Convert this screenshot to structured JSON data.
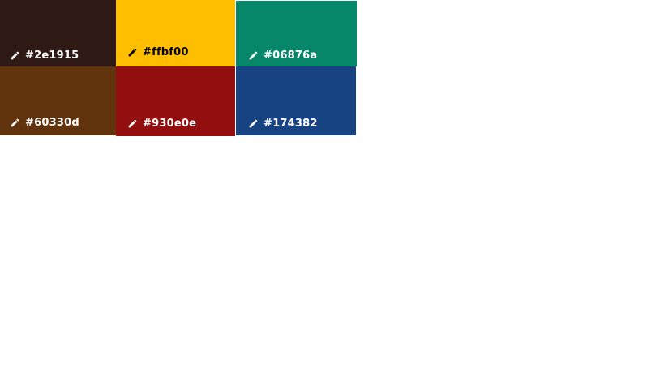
{
  "palette": {
    "swatches": [
      {
        "hex": "#2e1915",
        "label": "#2e1915",
        "text_color": "#ffffff",
        "icon": "pencil-icon"
      },
      {
        "hex": "#ffbf00",
        "label": "#ffbf00",
        "text_color": "#000000",
        "icon": "pencil-icon"
      },
      {
        "hex": "#06876a",
        "label": "#06876a",
        "text_color": "#ffffff",
        "icon": "pencil-icon"
      },
      {
        "hex": "#60330d",
        "label": "#60330d",
        "text_color": "#ffffff",
        "icon": "pencil-icon"
      },
      {
        "hex": "#930e0e",
        "label": "#930e0e",
        "text_color": "#ffffff",
        "icon": "pencil-icon"
      },
      {
        "hex": "#174382",
        "label": "#174382",
        "text_color": "#ffffff",
        "icon": "pencil-icon"
      }
    ]
  }
}
